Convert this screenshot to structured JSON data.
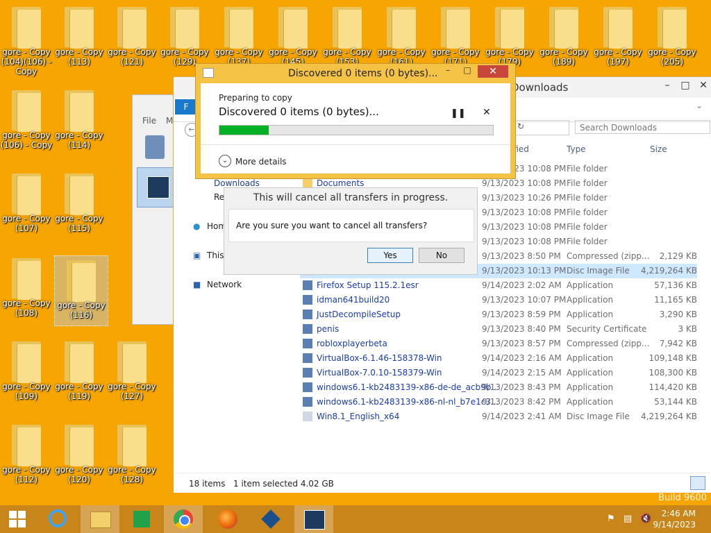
{
  "desktop": {
    "icons": [
      {
        "label": "gore - Copy (104)(106) - Copy"
      },
      {
        "label": "gore - Copy (113)"
      },
      {
        "label": "gore - Copy (121)"
      },
      {
        "label": "gore - Copy (129)"
      },
      {
        "label": "gore - Copy (137)"
      },
      {
        "label": "gore - Copy (145)"
      },
      {
        "label": "gore - Copy (153)"
      },
      {
        "label": "gore - Copy (161)"
      },
      {
        "label": "gore - Copy (171)"
      },
      {
        "label": "gore - Copy (179)"
      },
      {
        "label": "gore - Copy (189)"
      },
      {
        "label": "gore - Copy (197)"
      },
      {
        "label": "gore - Copy (205)"
      },
      {
        "label": "gore - Copy (106) - Copy"
      },
      {
        "label": "gore - Copy (114)"
      },
      {
        "label": "gore - Copy (107)"
      },
      {
        "label": "gore - Copy (115)"
      },
      {
        "label": "gore - Copy (108)"
      },
      {
        "label": "gore - Copy (116)"
      },
      {
        "label": "gore - Copy (109)"
      },
      {
        "label": "gore - Copy (119)"
      },
      {
        "label": "gore - Copy (127)"
      },
      {
        "label": "gore - Copy (112)"
      },
      {
        "label": "gore - Copy (120)"
      },
      {
        "label": "gore - Copy (128)"
      }
    ]
  },
  "explorer": {
    "title": "Downloads",
    "ribbon_file": "F",
    "vm_menu_file": "File",
    "vm_menu_m": "M",
    "search_placeholder": "Search Downloads",
    "columns": {
      "modified": "ified",
      "type": "Type",
      "size": "Size"
    },
    "nav": {
      "downloads": "Downloads",
      "recent": "Re",
      "home": "Hom",
      "this_pc": "This",
      "network": "Network"
    },
    "rows": [
      {
        "name": "",
        "date": "9/13/2023 10:08 PM",
        "type": "File folder",
        "size": ""
      },
      {
        "name": "Documents",
        "date": "9/13/2023 10:08 PM",
        "type": "File folder",
        "size": ""
      },
      {
        "name": "",
        "date": "9/13/2023 10:26 PM",
        "type": "File folder",
        "size": ""
      },
      {
        "name": "",
        "date": "9/13/2023 10:08 PM",
        "type": "File folder",
        "size": ""
      },
      {
        "name": "",
        "date": "9/13/2023 10:08 PM",
        "type": "File folder",
        "size": ""
      },
      {
        "name": "",
        "date": "9/13/2023 10:08 PM",
        "type": "File folder",
        "size": ""
      },
      {
        "name": "",
        "date": "9/13/2023 8:50 PM",
        "type": "Compressed (zipp...",
        "size": "2,129 KB"
      },
      {
        "name": "",
        "date": "9/13/2023 10:13 PM",
        "type": "Disc Image File",
        "size": "4,219,264 KB"
      },
      {
        "name": "Firefox Setup 115.2.1esr",
        "date": "9/14/2023 2:02 AM",
        "type": "Application",
        "size": "57,136 KB"
      },
      {
        "name": "idman641build20",
        "date": "9/13/2023 10:07 PM",
        "type": "Application",
        "size": "11,165 KB"
      },
      {
        "name": "JustDecompileSetup",
        "date": "9/13/2023 8:59 PM",
        "type": "Application",
        "size": "3,290 KB"
      },
      {
        "name": "penis",
        "date": "9/13/2023 8:40 PM",
        "type": "Security Certificate",
        "size": "3 KB"
      },
      {
        "name": "robloxplayerbeta",
        "date": "9/13/2023 8:57 PM",
        "type": "Compressed (zipp...",
        "size": "7,942 KB"
      },
      {
        "name": "VirtualBox-6.1.46-158378-Win",
        "date": "9/14/2023 2:16 AM",
        "type": "Application",
        "size": "109,148 KB"
      },
      {
        "name": "VirtualBox-7.0.10-158379-Win",
        "date": "9/14/2023 2:15 AM",
        "type": "Application",
        "size": "108,300 KB"
      },
      {
        "name": "windows6.1-kb2483139-x86-de-de_acb9b...",
        "date": "9/13/2023 8:43 PM",
        "type": "Application",
        "size": "114,420 KB"
      },
      {
        "name": "windows6.1-kb2483139-x86-nl-nl_b7e1c3...",
        "date": "9/13/2023 8:42 PM",
        "type": "Application",
        "size": "53,144 KB"
      },
      {
        "name": "Win8.1_English_x64",
        "date": "9/14/2023 2:41 AM",
        "type": "Disc Image File",
        "size": "4,219,264 KB"
      }
    ],
    "status": {
      "items": "18 items",
      "selected": "1 item selected  4.02 GB"
    }
  },
  "copy_dialog": {
    "title": "Discovered 0 items (0 bytes)...",
    "preparing": "Preparing to copy",
    "discovered": "Discovered 0 items (0 bytes)...",
    "progress": 0.18,
    "more_details": "More details"
  },
  "confirm_dialog": {
    "title": "This will cancel all transfers in progress.",
    "message": "Are you sure you want to cancel all transfers?",
    "yes": "Yes",
    "no": "No"
  },
  "taskbar": {
    "time": "2:46 AM",
    "date": "9/14/2023",
    "build": "Build 9600"
  },
  "colors": {
    "accent": "#f6a502",
    "taskbar": "#c8861a",
    "progress": "#06b025",
    "close": "#c9463d"
  }
}
